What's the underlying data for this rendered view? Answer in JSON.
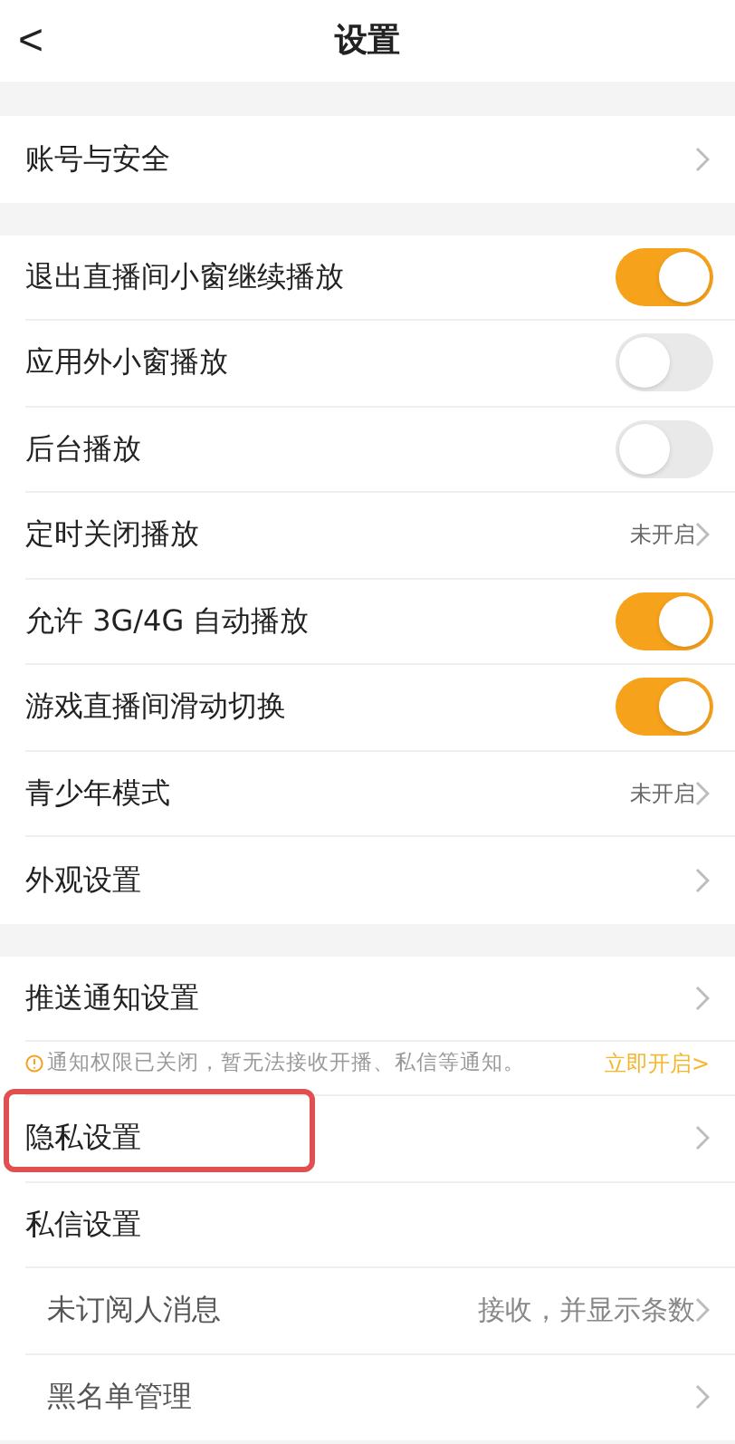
{
  "header": {
    "back": "<",
    "title": "设置"
  },
  "sections": [
    {
      "items": [
        {
          "kind": "link",
          "label": "账号与安全",
          "chevron": true
        }
      ]
    },
    {
      "items": [
        {
          "kind": "toggle",
          "label": "退出直播间小窗继续播放",
          "on": true
        },
        {
          "kind": "toggle",
          "label": "应用外小窗播放",
          "on": false
        },
        {
          "kind": "toggle",
          "label": "后台播放",
          "on": false
        },
        {
          "kind": "link",
          "label": "定时关闭播放",
          "value": "未开启",
          "chevron": true
        },
        {
          "kind": "toggle",
          "label": "允许 3G/4G 自动播放",
          "on": true
        },
        {
          "kind": "toggle",
          "label": "游戏直播间滑动切换",
          "on": true
        },
        {
          "kind": "link",
          "label": "青少年模式",
          "value": "未开启",
          "chevron": true
        },
        {
          "kind": "link",
          "label": "外观设置",
          "chevron": true
        }
      ]
    },
    {
      "items": [
        {
          "kind": "link",
          "label": "推送通知设置",
          "chevron": true
        },
        {
          "kind": "notice",
          "text": "通知权限已关闭，暂无法接收开播、私信等通知。",
          "action": "立即开启>"
        },
        {
          "kind": "link",
          "label": "隐私设置",
          "chevron": true,
          "highlighted": true
        },
        {
          "kind": "link",
          "label": "私信设置",
          "chevron": false
        },
        {
          "kind": "sub",
          "label": "未订阅人消息",
          "value": "接收，并显示条数",
          "chevron": true
        },
        {
          "kind": "sub",
          "label": "黑名单管理",
          "chevron": true
        }
      ]
    }
  ]
}
